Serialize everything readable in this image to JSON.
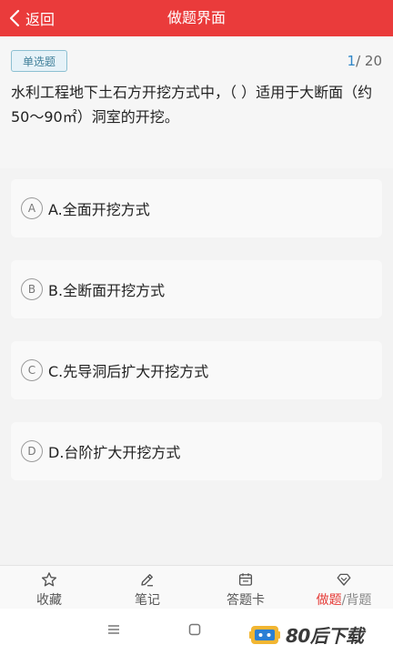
{
  "header": {
    "back_label": "返回",
    "title": "做题界面"
  },
  "question": {
    "type_badge": "单选题",
    "progress_current": "1",
    "progress_total": "/ 20",
    "text": "水利工程地下土石方开挖方式中，（    ）适用于大断面（约50～90㎡）洞室的开挖。"
  },
  "options": [
    {
      "letter": "A",
      "text": "A.全面开挖方式"
    },
    {
      "letter": "B",
      "text": "B.全断面开挖方式"
    },
    {
      "letter": "C",
      "text": "C.先导洞后扩大开挖方式"
    },
    {
      "letter": "D",
      "text": "D.台阶扩大开挖方式"
    }
  ],
  "tabbar": {
    "favorite": "收藏",
    "notes": "笔记",
    "answer_card": "答题卡",
    "mode_active": "做题",
    "mode_sep": "/",
    "mode_inactive": "背题"
  },
  "watermark": {
    "text": "80后下载"
  },
  "icons": {
    "back": "chevron-left-icon",
    "favorite": "star-icon",
    "notes": "pen-icon",
    "answer_card": "calendar-icon",
    "mode": "diamond-icon",
    "nav_menu": "menu-icon",
    "nav_home": "square-icon"
  },
  "colors": {
    "header_bg": "#ea3b3b",
    "accent_blue": "#2f86c8",
    "active_red": "#e53935"
  }
}
